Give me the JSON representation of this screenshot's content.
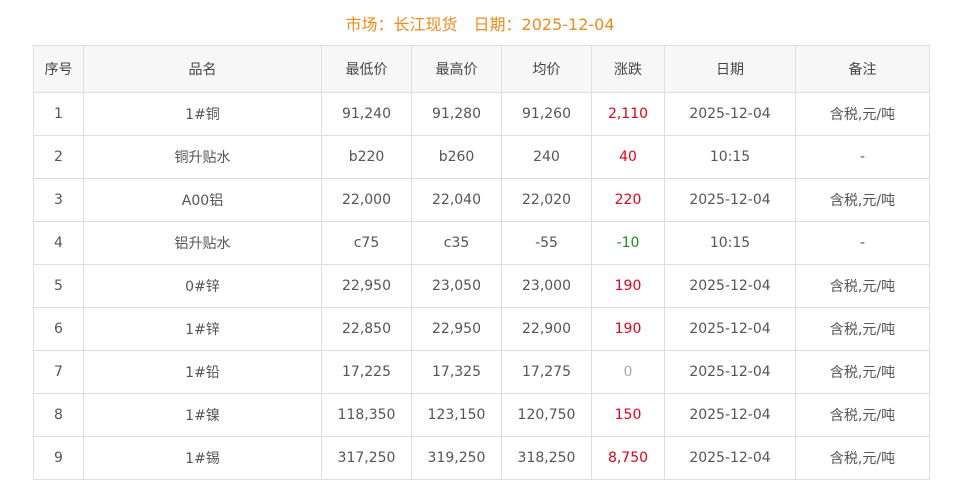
{
  "header": {
    "market_label": "市场：",
    "market_value": "长江现货",
    "date_label": "日期：",
    "date_value": "2025-12-04"
  },
  "columns": [
    "序号",
    "品名",
    "最低价",
    "最高价",
    "均价",
    "涨跌",
    "日期",
    "备注"
  ],
  "rows": [
    {
      "no": "1",
      "name": "1#铜",
      "low": "91,240",
      "high": "91,280",
      "avg": "91,260",
      "change": "2,110",
      "trend": "up",
      "date": "2025-12-04",
      "note": "含税,元/吨"
    },
    {
      "no": "2",
      "name": "铜升贴水",
      "low": "b220",
      "high": "b260",
      "avg": "240",
      "change": "40",
      "trend": "up",
      "date": "10:15",
      "note": "-"
    },
    {
      "no": "3",
      "name": "A00铝",
      "low": "22,000",
      "high": "22,040",
      "avg": "22,020",
      "change": "220",
      "trend": "up",
      "date": "2025-12-04",
      "note": "含税,元/吨"
    },
    {
      "no": "4",
      "name": "铝升贴水",
      "low": "c75",
      "high": "c35",
      "avg": "-55",
      "change": "-10",
      "trend": "down",
      "date": "10:15",
      "note": "-"
    },
    {
      "no": "5",
      "name": "0#锌",
      "low": "22,950",
      "high": "23,050",
      "avg": "23,000",
      "change": "190",
      "trend": "up",
      "date": "2025-12-04",
      "note": "含税,元/吨"
    },
    {
      "no": "6",
      "name": "1#锌",
      "low": "22,850",
      "high": "22,950",
      "avg": "22,900",
      "change": "190",
      "trend": "up",
      "date": "2025-12-04",
      "note": "含税,元/吨"
    },
    {
      "no": "7",
      "name": "1#铅",
      "low": "17,225",
      "high": "17,325",
      "avg": "17,275",
      "change": "0",
      "trend": "flat",
      "date": "2025-12-04",
      "note": "含税,元/吨"
    },
    {
      "no": "8",
      "name": "1#镍",
      "low": "118,350",
      "high": "123,150",
      "avg": "120,750",
      "change": "150",
      "trend": "up",
      "date": "2025-12-04",
      "note": "含税,元/吨"
    },
    {
      "no": "9",
      "name": "1#锡",
      "low": "317,250",
      "high": "319,250",
      "avg": "318,250",
      "change": "8,750",
      "trend": "up",
      "date": "2025-12-04",
      "note": "含税,元/吨"
    }
  ],
  "colors": {
    "header_accent": "#ef8a1b",
    "up": "#e2001a",
    "down": "#1e8c1e",
    "flat": "#aaaaaa"
  }
}
